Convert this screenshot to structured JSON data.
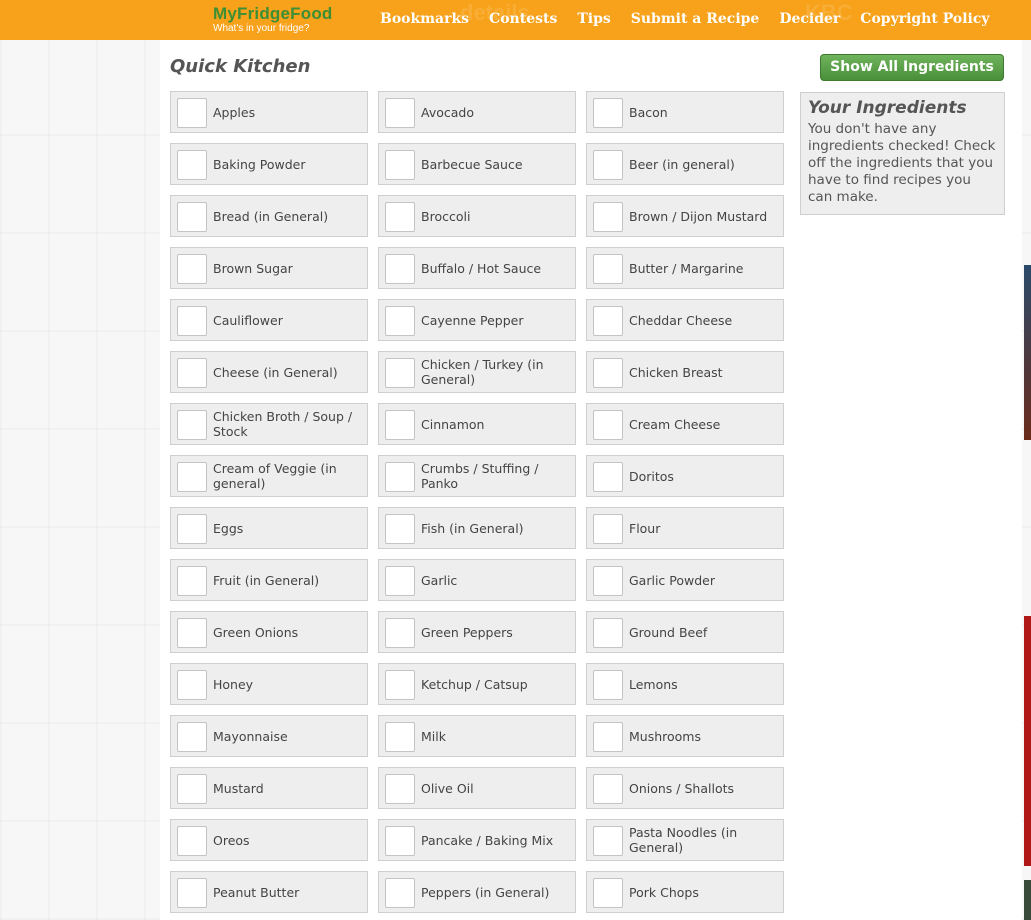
{
  "site": {
    "name": "MyFridgeFood",
    "tagline": "What's in your fridge?"
  },
  "nav": [
    "Bookmarks",
    "Contests",
    "Tips",
    "Submit a Recipe",
    "Decider",
    "Copyright Policy"
  ],
  "header_ghost_text": [
    "details",
    "KBC"
  ],
  "page_title": "Quick Kitchen",
  "show_all_label": "Show All Ingredients",
  "your_ingredients": {
    "title": "Your Ingredients",
    "message": "You don't have any ingredients checked! Check off the ingredients that you have to find recipes you can make."
  },
  "ingredients": [
    "Apples",
    "Avocado",
    "Bacon",
    "Baking Powder",
    "Barbecue Sauce",
    "Beer (in general)",
    "Bread (in General)",
    "Broccoli",
    "Brown / Dijon Mustard",
    "Brown Sugar",
    "Buffalo / Hot Sauce",
    "Butter / Margarine",
    "Cauliflower",
    "Cayenne Pepper",
    "Cheddar Cheese",
    "Cheese (in General)",
    "Chicken / Turkey (in General)",
    "Chicken Breast",
    "Chicken Broth / Soup / Stock",
    "Cinnamon",
    "Cream Cheese",
    "Cream of Veggie (in general)",
    "Crumbs / Stuffing / Panko",
    "Doritos",
    "Eggs",
    "Fish (in General)",
    "Flour",
    "Fruit (in General)",
    "Garlic",
    "Garlic Powder",
    "Green Onions",
    "Green Peppers",
    "Ground Beef",
    "Honey",
    "Ketchup / Catsup",
    "Lemons",
    "Mayonnaise",
    "Milk",
    "Mushrooms",
    "Mustard",
    "Olive Oil",
    "Onions / Shallots",
    "Oreos",
    "Pancake / Baking Mix",
    "Pasta Noodles (in General)",
    "Peanut Butter",
    "Peppers (in General)",
    "Pork Chops"
  ],
  "colors": {
    "header": "#f7a21a",
    "logo": "#3d8f35",
    "button": "#5aa04a",
    "card": "#eeeeee"
  }
}
